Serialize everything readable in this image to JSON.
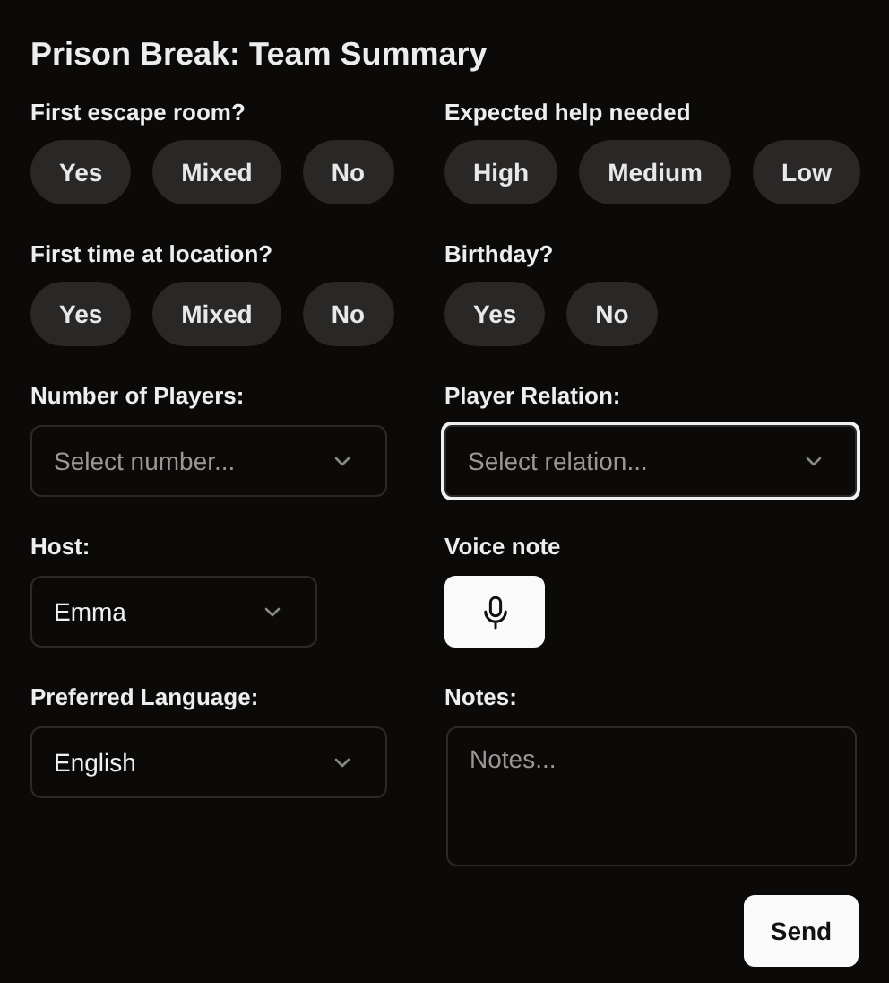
{
  "title": "Prison Break: Team Summary",
  "fields": [
    {
      "kind": "choices",
      "label": "First escape room?",
      "options": [
        {
          "label": "Yes",
          "selected": false
        },
        {
          "label": "Mixed",
          "selected": false
        },
        {
          "label": "No",
          "selected": false
        }
      ]
    },
    {
      "kind": "choices",
      "label": "Expected help needed",
      "options": [
        {
          "label": "High",
          "selected": false
        },
        {
          "label": "Medium",
          "selected": false
        },
        {
          "label": "Low",
          "selected": false
        }
      ]
    },
    {
      "kind": "choices",
      "label": "First time at location?",
      "options": [
        {
          "label": "Yes",
          "selected": false
        },
        {
          "label": "Mixed",
          "selected": false
        },
        {
          "label": "No",
          "selected": false
        }
      ]
    },
    {
      "kind": "choices",
      "label": "Birthday?",
      "options": [
        {
          "label": "Yes",
          "selected": false
        },
        {
          "label": "No",
          "selected": false
        }
      ]
    },
    {
      "kind": "select",
      "label": "Number of Players:",
      "placeholder": "Select number...",
      "focused": false
    },
    {
      "kind": "select",
      "label": "Player Relation:",
      "placeholder": "Select relation...",
      "focused": true
    },
    {
      "kind": "select",
      "label": "Host:",
      "value": "Emma",
      "focused": false
    },
    {
      "kind": "voice",
      "label": "Voice note"
    },
    {
      "kind": "select",
      "label": "Preferred Language:",
      "value": "English",
      "focused": false
    },
    {
      "kind": "textarea",
      "label": "Notes:",
      "placeholder": "Notes..."
    }
  ],
  "send_button": "Send"
}
